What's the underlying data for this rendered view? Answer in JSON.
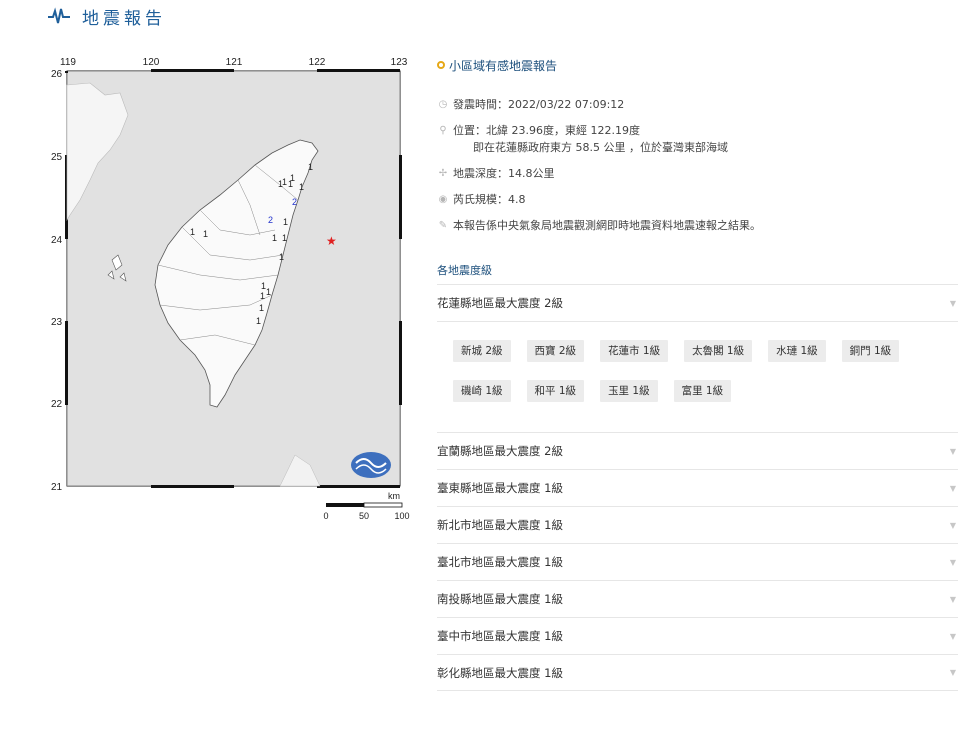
{
  "header": {
    "title": "地震報告",
    "icon": "pulse-icon"
  },
  "map": {
    "top_ticks": [
      "119",
      "120",
      "121",
      "122",
      "123"
    ],
    "left_ticks": [
      "26",
      "25",
      "24",
      "23",
      "22",
      "21"
    ],
    "scale": {
      "unit": "km",
      "labels": [
        "0",
        "50",
        "100"
      ]
    },
    "intensity_labels": [
      "1",
      "1",
      "1",
      "1",
      "1",
      "1",
      "2",
      "2",
      "1",
      "1",
      "1",
      "1",
      "1",
      "1",
      "1",
      "1",
      "1",
      "1",
      "1"
    ],
    "colors": {
      "sea": "#dcdcdc",
      "land": "#ffffff",
      "epicenter": "#e02020",
      "level2": "#2233cc"
    }
  },
  "report": {
    "title": "小區域有感地震報告",
    "time": "發震時間：2022/03/22 07:09:12",
    "location": "位置：北緯 23.96度，東經 122.19度",
    "location_detail": "即在花蓮縣政府東方 58.5 公里 ，位於臺灣東部海域",
    "depth": "地震深度：14.8公里",
    "magnitude": "芮氏規模：4.8",
    "note": "本報告係中央氣象局地震觀測網即時地震資料地震速報之結果。",
    "intensity_section": "各地震度級"
  },
  "regions": [
    {
      "label": "花蓮縣地區最大震度 2級",
      "expanded": true,
      "towns": [
        "新城 2級",
        "西寶 2級",
        "花蓮市 1級",
        "太魯閣 1級",
        "水璉 1級",
        "銅門 1級",
        "磯崎 1級",
        "和平 1級",
        "玉里 1級",
        "富里 1級"
      ]
    },
    {
      "label": "宜蘭縣地區最大震度 2級"
    },
    {
      "label": "臺東縣地區最大震度 1級"
    },
    {
      "label": "新北市地區最大震度 1級"
    },
    {
      "label": "臺北市地區最大震度 1級"
    },
    {
      "label": "南投縣地區最大震度 1級"
    },
    {
      "label": "臺中市地區最大震度 1級"
    },
    {
      "label": "彰化縣地區最大震度 1級"
    }
  ]
}
